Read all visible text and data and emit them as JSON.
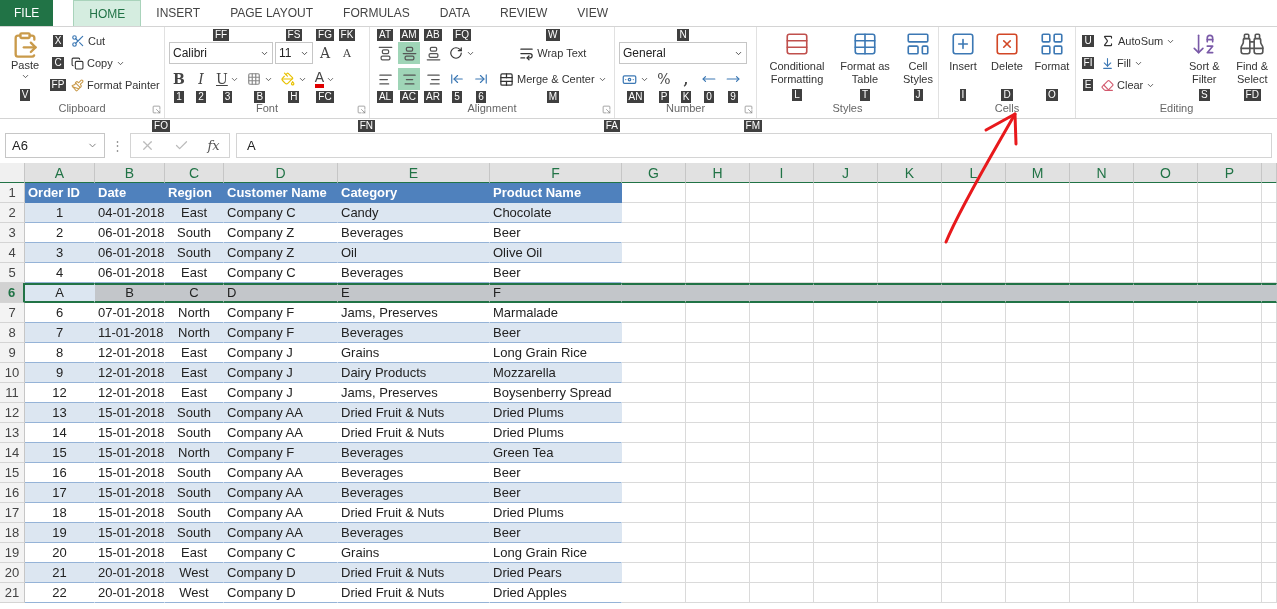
{
  "tabs": [
    {
      "label": "FILE",
      "kind": "file",
      "selected": false
    },
    {
      "label": "HOME",
      "kind": "tab",
      "selected": true
    },
    {
      "label": "INSERT",
      "kind": "tab",
      "selected": false
    },
    {
      "label": "PAGE LAYOUT",
      "kind": "tab",
      "selected": false
    },
    {
      "label": "FORMULAS",
      "kind": "tab",
      "selected": false
    },
    {
      "label": "DATA",
      "kind": "tab",
      "selected": false
    },
    {
      "label": "REVIEW",
      "kind": "tab",
      "selected": false
    },
    {
      "label": "VIEW",
      "kind": "tab",
      "selected": false
    }
  ],
  "ribbon": {
    "clipboard": {
      "label": "Clipboard",
      "launcher_keytip": "FO",
      "paste": {
        "label": "Paste",
        "keytip": "V"
      },
      "cut": {
        "label": "Cut",
        "keytip": "X"
      },
      "copy": {
        "label": "Copy",
        "keytip": "C"
      },
      "format_painter": {
        "label": "Format Painter",
        "keytip": "FP"
      }
    },
    "font": {
      "label": "Font",
      "launcher_keytip": "FN",
      "font_name": {
        "value": "Calibri",
        "keytip": "FF"
      },
      "font_size": {
        "value": "11",
        "keytip": "FS"
      },
      "grow": {
        "label": "A",
        "keytip": "FG"
      },
      "shrink": {
        "label": "A",
        "keytip": "FK"
      },
      "bold": {
        "label": "B",
        "keytip": "1"
      },
      "italic": {
        "label": "I",
        "keytip": "2"
      },
      "underline": {
        "label": "U",
        "keytip": "3"
      },
      "borders": {
        "keytip": "B"
      },
      "fill": {
        "keytip": "H"
      },
      "font_color": {
        "label": "A",
        "keytip": "FC"
      }
    },
    "alignment": {
      "label": "Alignment",
      "launcher_keytip": "FA",
      "vertical": [
        {
          "kind": "top",
          "keytip": "AT",
          "selected": false
        },
        {
          "kind": "middle",
          "keytip": "AM",
          "selected": true
        },
        {
          "kind": "bottom",
          "keytip": "AB",
          "selected": false
        }
      ],
      "horizontal": [
        {
          "kind": "left",
          "keytip": "AL",
          "selected": false
        },
        {
          "kind": "center",
          "keytip": "AC",
          "selected": true
        },
        {
          "kind": "right",
          "keytip": "AR",
          "selected": false
        }
      ],
      "orientation": {
        "keytip": "FQ"
      },
      "decrease_indent": {
        "keytip": "5"
      },
      "increase_indent": {
        "keytip": "6"
      },
      "wrap_text": {
        "label": "Wrap Text",
        "keytip": "W"
      },
      "merge": {
        "label": "Merge & Center",
        "keytip": "M"
      }
    },
    "number": {
      "label": "Number",
      "launcher_keytip": "FM",
      "format": {
        "value": "General",
        "keytip": "N"
      },
      "accounting": {
        "keytip": "AN"
      },
      "percent": {
        "label": "%",
        "keytip": "P"
      },
      "comma": {
        "label": ",",
        "keytip": "K"
      },
      "increase_decimal": {
        "keytip": "0"
      },
      "decrease_decimal": {
        "keytip": "9"
      }
    },
    "styles": {
      "label": "Styles",
      "buttons": [
        {
          "kind": "conditional",
          "label": "Conditional Formatting",
          "keytip": "L"
        },
        {
          "kind": "table",
          "label": "Format as Table",
          "keytip": "T"
        },
        {
          "kind": "cellstyles",
          "label": "Cell Styles",
          "keytip": "J"
        }
      ]
    },
    "cells": {
      "label": "Cells",
      "buttons": [
        {
          "kind": "insert",
          "label": "Insert",
          "keytip": "I"
        },
        {
          "kind": "delete",
          "label": "Delete",
          "keytip": "D"
        },
        {
          "kind": "format",
          "label": "Format",
          "keytip": "O"
        }
      ]
    },
    "editing": {
      "label": "Editing",
      "autosum": {
        "label": "AutoSum",
        "keytip": "U"
      },
      "fill": {
        "label": "Fill",
        "keytip": "FI"
      },
      "clear": {
        "label": "Clear",
        "keytip": "E"
      },
      "buttons": [
        {
          "kind": "sort",
          "label": "Sort & Filter",
          "keytip": "S"
        },
        {
          "kind": "find",
          "label": "Find & Select",
          "keytip": "FD"
        }
      ]
    }
  },
  "formula_bar": {
    "name_box": "A6",
    "more": "⋮",
    "fx": "fx",
    "value": "A"
  },
  "sheet": {
    "columns": [
      "A",
      "B",
      "C",
      "D",
      "E",
      "F",
      "G",
      "H",
      "I",
      "J",
      "K",
      "L",
      "M",
      "N",
      "O",
      "P"
    ],
    "rows": [
      {
        "number": "1",
        "kind": "header",
        "selected": false,
        "banded": false,
        "cells": [
          "Order ID",
          "Date",
          "Region",
          "Customer Name",
          "Category",
          "Product Name"
        ]
      },
      {
        "number": "2",
        "kind": "data",
        "selected": false,
        "banded": true,
        "cells": [
          "1",
          "04-01-2018",
          "East",
          "Company C",
          "Candy",
          "Chocolate"
        ]
      },
      {
        "number": "3",
        "kind": "data",
        "selected": false,
        "banded": false,
        "cells": [
          "2",
          "06-01-2018",
          "South",
          "Company Z",
          "Beverages",
          "Beer"
        ]
      },
      {
        "number": "4",
        "kind": "data",
        "selected": false,
        "banded": true,
        "cells": [
          "3",
          "06-01-2018",
          "South",
          "Company Z",
          "Oil",
          "Olive Oil"
        ]
      },
      {
        "number": "5",
        "kind": "data",
        "selected": false,
        "banded": false,
        "cells": [
          "4",
          "06-01-2018",
          "East",
          "Company C",
          "Beverages",
          "Beer"
        ]
      },
      {
        "number": "6",
        "kind": "data",
        "selected": true,
        "banded": true,
        "cells": [
          "A",
          "B",
          "C",
          "D",
          "E",
          "F"
        ]
      },
      {
        "number": "7",
        "kind": "data",
        "selected": false,
        "banded": false,
        "cells": [
          "6",
          "07-01-2018",
          "North",
          "Company F",
          "Jams, Preserves",
          "Marmalade"
        ]
      },
      {
        "number": "8",
        "kind": "data",
        "selected": false,
        "banded": true,
        "cells": [
          "7",
          "11-01-2018",
          "North",
          "Company F",
          "Beverages",
          "Beer"
        ]
      },
      {
        "number": "9",
        "kind": "data",
        "selected": false,
        "banded": false,
        "cells": [
          "8",
          "12-01-2018",
          "East",
          "Company J",
          "Grains",
          "Long Grain Rice"
        ]
      },
      {
        "number": "10",
        "kind": "data",
        "selected": false,
        "banded": true,
        "cells": [
          "9",
          "12-01-2018",
          "East",
          "Company J",
          "Dairy Products",
          "Mozzarella"
        ]
      },
      {
        "number": "11",
        "kind": "data",
        "selected": false,
        "banded": false,
        "cells": [
          "12",
          "12-01-2018",
          "East",
          "Company J",
          "Jams, Preserves",
          "Boysenberry Spread"
        ]
      },
      {
        "number": "12",
        "kind": "data",
        "selected": false,
        "banded": true,
        "cells": [
          "13",
          "15-01-2018",
          "South",
          "Company AA",
          "Dried Fruit & Nuts",
          "Dried Plums"
        ]
      },
      {
        "number": "13",
        "kind": "data",
        "selected": false,
        "banded": false,
        "cells": [
          "14",
          "15-01-2018",
          "South",
          "Company AA",
          "Dried Fruit & Nuts",
          "Dried Plums"
        ]
      },
      {
        "number": "14",
        "kind": "data",
        "selected": false,
        "banded": true,
        "cells": [
          "15",
          "15-01-2018",
          "North",
          "Company F",
          "Beverages",
          "Green Tea"
        ]
      },
      {
        "number": "15",
        "kind": "data",
        "selected": false,
        "banded": false,
        "cells": [
          "16",
          "15-01-2018",
          "South",
          "Company AA",
          "Beverages",
          "Beer"
        ]
      },
      {
        "number": "16",
        "kind": "data",
        "selected": false,
        "banded": true,
        "cells": [
          "17",
          "15-01-2018",
          "South",
          "Company AA",
          "Beverages",
          "Beer"
        ]
      },
      {
        "number": "17",
        "kind": "data",
        "selected": false,
        "banded": false,
        "cells": [
          "18",
          "15-01-2018",
          "South",
          "Company AA",
          "Dried Fruit & Nuts",
          "Dried Plums"
        ]
      },
      {
        "number": "18",
        "kind": "data",
        "selected": false,
        "banded": true,
        "cells": [
          "19",
          "15-01-2018",
          "South",
          "Company AA",
          "Beverages",
          "Beer"
        ]
      },
      {
        "number": "19",
        "kind": "data",
        "selected": false,
        "banded": false,
        "cells": [
          "20",
          "15-01-2018",
          "East",
          "Company C",
          "Grains",
          "Long Grain Rice"
        ]
      },
      {
        "number": "20",
        "kind": "data",
        "selected": false,
        "banded": true,
        "cells": [
          "21",
          "20-01-2018",
          "West",
          "Company D",
          "Dried Fruit & Nuts",
          "Dried Pears"
        ]
      },
      {
        "number": "21",
        "kind": "data",
        "selected": false,
        "banded": false,
        "cells": [
          "22",
          "20-01-2018",
          "West",
          "Company D",
          "Dried Fruit & Nuts",
          "Dried Apples"
        ]
      }
    ]
  }
}
